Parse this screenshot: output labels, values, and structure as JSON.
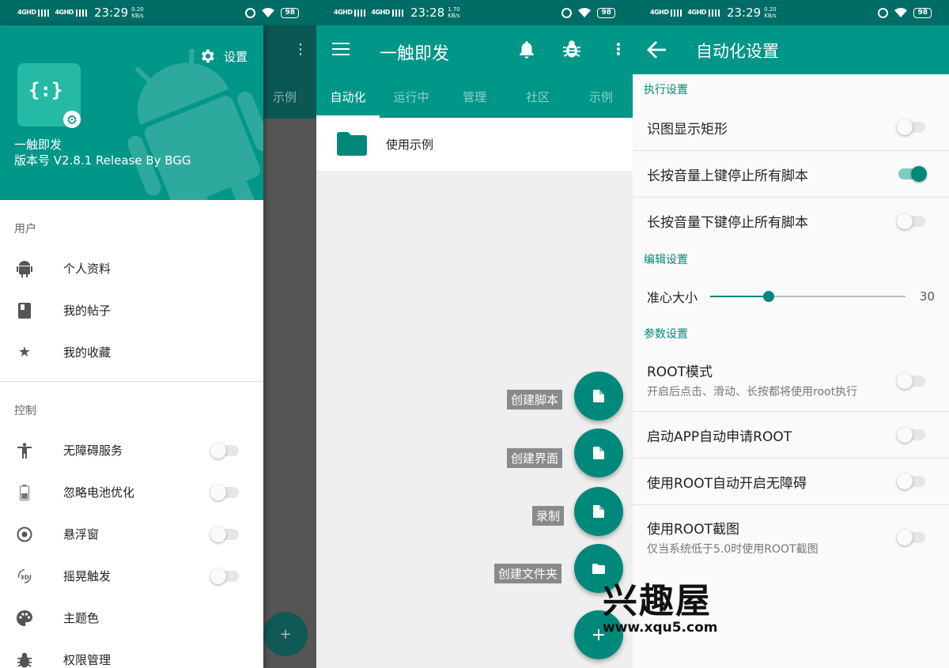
{
  "panel1": {
    "status": {
      "sig1": "4GHD",
      "sig2": "4GHD",
      "time": "23:29",
      "speed": "0.20",
      "speed_unit": "KB/s",
      "battery": "98"
    },
    "settings_label": "设置",
    "app_name": "一触即发",
    "app_version": "版本号 V2.8.1 Release By BGG",
    "underlay_tab": "示例",
    "underlay_fab": "+",
    "sections": [
      {
        "title": "用户",
        "items": [
          {
            "label": "个人资料",
            "icon": "android-icon"
          },
          {
            "label": "我的帖子",
            "icon": "book-icon"
          },
          {
            "label": "我的收藏",
            "icon": "star-icon"
          }
        ]
      },
      {
        "title": "控制",
        "items": [
          {
            "label": "无障碍服务",
            "icon": "accessibility-icon",
            "toggle": false
          },
          {
            "label": "忽略电池优化",
            "icon": "battery-icon",
            "toggle": false
          },
          {
            "label": "悬浮窗",
            "icon": "floating-window-icon",
            "toggle": false
          },
          {
            "label": "摇晃触发",
            "icon": "shake-3d-icon",
            "toggle": false
          },
          {
            "label": "主题色",
            "icon": "palette-icon"
          },
          {
            "label": "权限管理",
            "icon": "bug-icon"
          }
        ]
      }
    ]
  },
  "panel2": {
    "status": {
      "sig1": "4GHD",
      "sig2": "4GHD",
      "time": "23:28",
      "speed": "1.70",
      "speed_unit": "KB/s",
      "battery": "98"
    },
    "title": "一触即发",
    "tabs": [
      "自动化",
      "运行中",
      "管理",
      "社区",
      "示例"
    ],
    "active_tab": "自动化",
    "folder_label": "使用示例",
    "fabs": [
      "创建脚本",
      "创建界面",
      "录制",
      "创建文件夹"
    ],
    "main_fab": "+"
  },
  "panel3": {
    "status": {
      "sig1": "4GHD",
      "sig2": "4GHD",
      "time": "23:29",
      "speed": "0.20",
      "speed_unit": "KB/s",
      "battery": "98"
    },
    "title": "自动化设置",
    "exec_section": "执行设置",
    "exec_items": [
      {
        "label": "识图显示矩形",
        "on": false
      },
      {
        "label": "长按音量上键停止所有脚本",
        "on": true
      },
      {
        "label": "长按音量下键停止所有脚本",
        "on": false
      }
    ],
    "edit_section": "编辑设置",
    "crosshair_label": "准心大小",
    "crosshair_value": "30",
    "crosshair_fraction": 0.3,
    "param_section": "参数设置",
    "root_mode": {
      "label": "ROOT模式",
      "sub": "开启后点击、滑动、长按都将使用root执行",
      "on": false
    },
    "param_items": [
      {
        "label": "启动APP自动申请ROOT",
        "on": false
      },
      {
        "label": "使用ROOT自动开启无障碍",
        "on": false
      }
    ],
    "root_screenshot": {
      "label": "使用ROOT截图",
      "sub": "仅当系统低于5.0时使用ROOT截图",
      "on": false
    }
  },
  "watermark": {
    "title": "兴趣屋",
    "url": "www.xqu5.com"
  },
  "colors": {
    "primary": "#009688",
    "status": "#006c66",
    "accent": "#00897b"
  }
}
